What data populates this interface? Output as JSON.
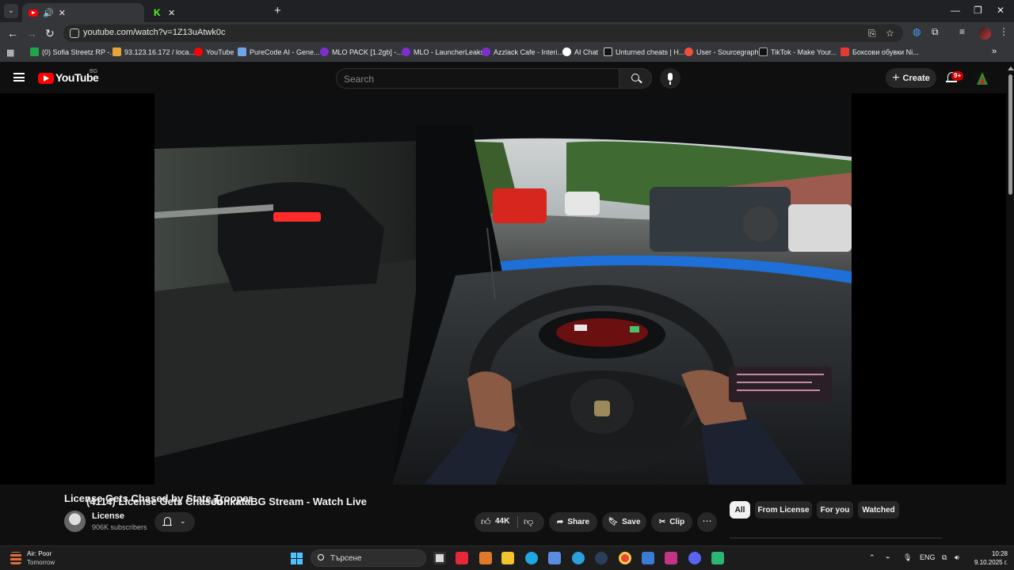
{
  "browser": {
    "tabs": [
      {
        "title": "(4114) License Gets Chased",
        "active": true
      },
      {
        "title": "JonkataBG Stream - Watch Live",
        "active": false
      }
    ],
    "url": "youtube.com/watch?v=1Z13uAtwk0c",
    "bookmarks": [
      "(0) Sofia Streetz RP -...",
      "93.123.16.172 / loca...",
      "YouTube",
      "PureCode AI - Gene...",
      "MLO PACK [1.2gb] -...",
      "MLO - LauncherLeaks",
      "Azzlack Cafe - Interi...",
      "AI Chat",
      "Unturned cheats | H...",
      "User - Sourcegraph",
      "TikTok - Make Your...",
      "Боксови обувки Ni..."
    ]
  },
  "youtube": {
    "logo_text": "YouTube",
    "region": "BG",
    "search_placeholder": "Search",
    "create_label": "Create",
    "notifications": "9+"
  },
  "video": {
    "title": "License Gets Chased by State Trooper",
    "channel": "License",
    "subscribers": "906K subscribers",
    "likes": "44K",
    "share_label": "Share",
    "save_label": "Save",
    "clip_label": "Clip"
  },
  "chips": [
    "All",
    "From License",
    "For you",
    "Watched"
  ],
  "taskbar": {
    "weather_line1": "Air: Poor",
    "weather_line2": "Tomorrow",
    "search_text": "Търсене",
    "lang": "ENG",
    "time": "10:28",
    "date": "9.10.2025 г."
  }
}
